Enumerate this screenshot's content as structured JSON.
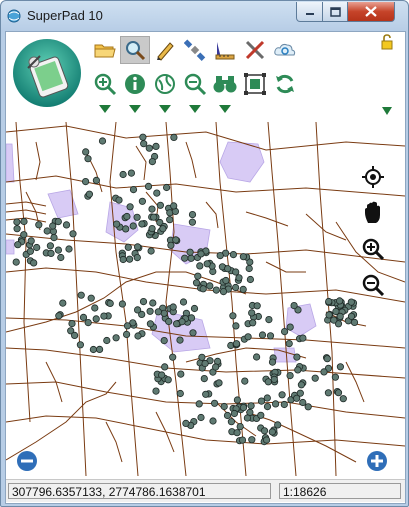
{
  "window": {
    "title": "SuperPad 10"
  },
  "toolbar": {
    "row1": [
      {
        "name": "open-folder-icon"
      },
      {
        "name": "query-magnifier-icon",
        "active": true
      },
      {
        "name": "pen-edit-icon"
      },
      {
        "name": "satellite-icon"
      },
      {
        "name": "measure-ruler-icon"
      },
      {
        "name": "tools-cross-icon"
      },
      {
        "name": "cloud-sync-icon"
      }
    ],
    "row2": [
      {
        "name": "zoom-in-icon"
      },
      {
        "name": "info-icon"
      },
      {
        "name": "layers-globe-icon"
      },
      {
        "name": "zoom-out-icon"
      },
      {
        "name": "binoculars-icon"
      },
      {
        "name": "select-box-icon"
      },
      {
        "name": "refresh-icon"
      }
    ]
  },
  "map": {
    "polygon_color": "#d8cbf5",
    "road_color": "#7a3b12",
    "point_color": "#5f7a72",
    "side_tools": [
      "locate-icon",
      "pan-hand-icon",
      "zoom-in-icon",
      "zoom-out-icon"
    ]
  },
  "status": {
    "coordinates": "307796.6357133, 2774786.1638701",
    "scale": "1:18626"
  }
}
